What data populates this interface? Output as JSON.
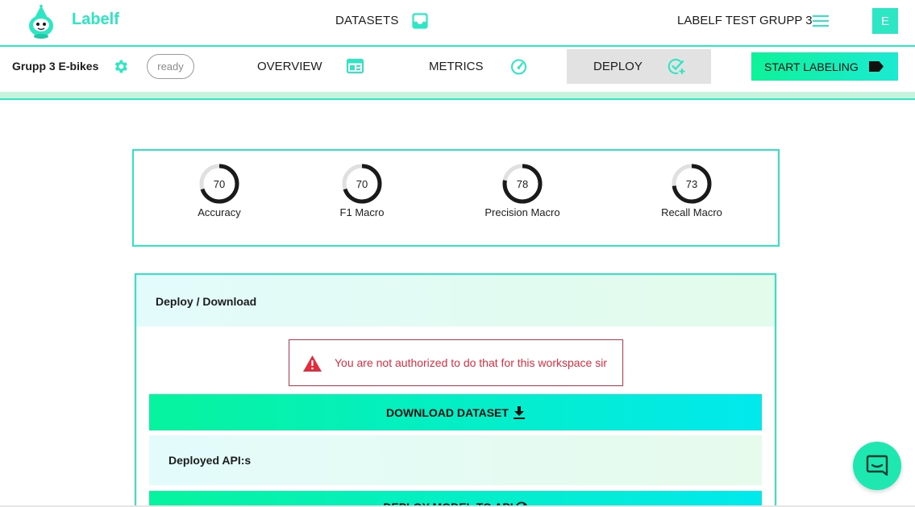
{
  "topbar": {
    "brand": "Labelf",
    "datasets_label": "DATASETS",
    "workspace_label": "LABELF TEST GRUPP 3",
    "avatar_initial": "E"
  },
  "subbar": {
    "project_name": "Grupp 3 E-bikes",
    "status": "ready",
    "tabs": {
      "overview": "OVERVIEW",
      "metrics": "METRICS",
      "deploy": "DEPLOY"
    },
    "start_labeling": "START LABELING"
  },
  "metrics": [
    {
      "label": "Accuracy",
      "value": "70",
      "fraction": 0.7
    },
    {
      "label": "F1 Macro",
      "value": "70",
      "fraction": 0.7
    },
    {
      "label": "Precision Macro",
      "value": "78",
      "fraction": 0.78
    },
    {
      "label": "Recall Macro",
      "value": "73",
      "fraction": 0.73
    }
  ],
  "deploy_panel": {
    "title": "Deploy / Download",
    "alert_text": "You are not authorized to do that for this workspace sir",
    "download_button": "DOWNLOAD DATASET",
    "deployed_apis_title": "Deployed API:s",
    "deploy_button": "DEPLOY MODEL TO API"
  },
  "colors": {
    "accent": "#2ce6c4",
    "error": "#e02e3f",
    "ring_track": "#e0e0e0",
    "ring_fill": "#1a1a1a"
  }
}
